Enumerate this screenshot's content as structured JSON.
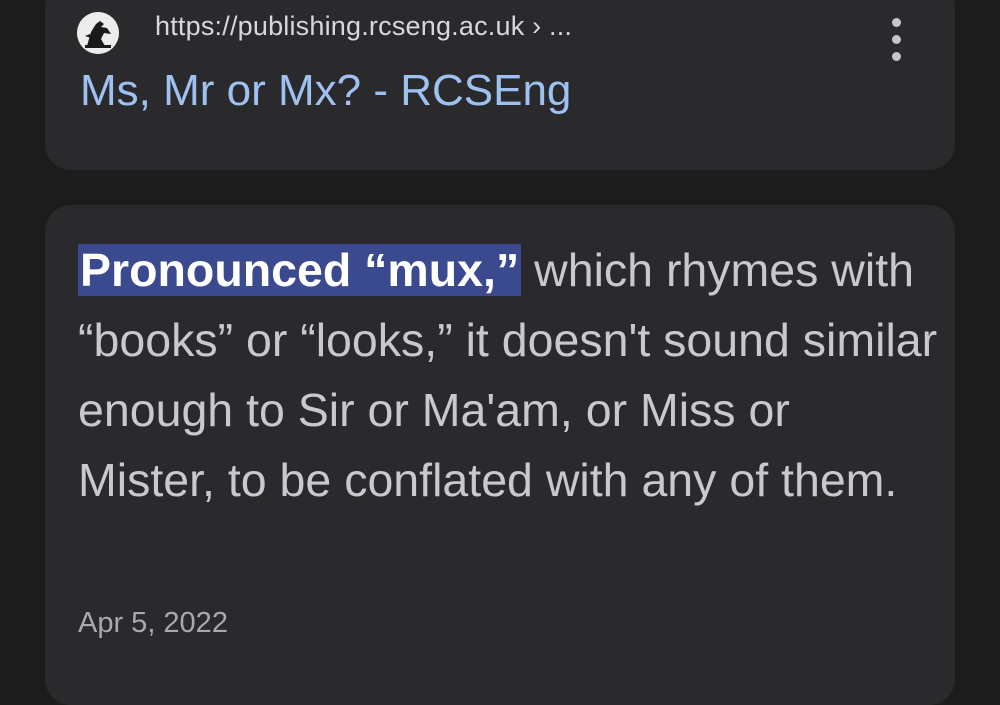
{
  "result": {
    "favicon_icon": "heraldic-bird-icon",
    "url": "https://publishing.rcseng.ac.uk",
    "breadcrumb_separator": "›",
    "breadcrumb_more": "...",
    "title": "Ms, Mr or Mx? - RCSEng",
    "menu_icon": "more-vert-icon"
  },
  "snippet": {
    "highlight": "Pronounced “mux,”",
    "text": " which rhymes with “books” or “looks,” it doesn't sound similar enough to Sir or Ma'am, or Miss or Mister, to be conflated with any of them.",
    "date": "Apr 5, 2022"
  },
  "colors": {
    "background": "#1c1c1d",
    "card": "#2a2a2c",
    "link": "#9fc1f2",
    "highlight": "#3b4a8e"
  }
}
